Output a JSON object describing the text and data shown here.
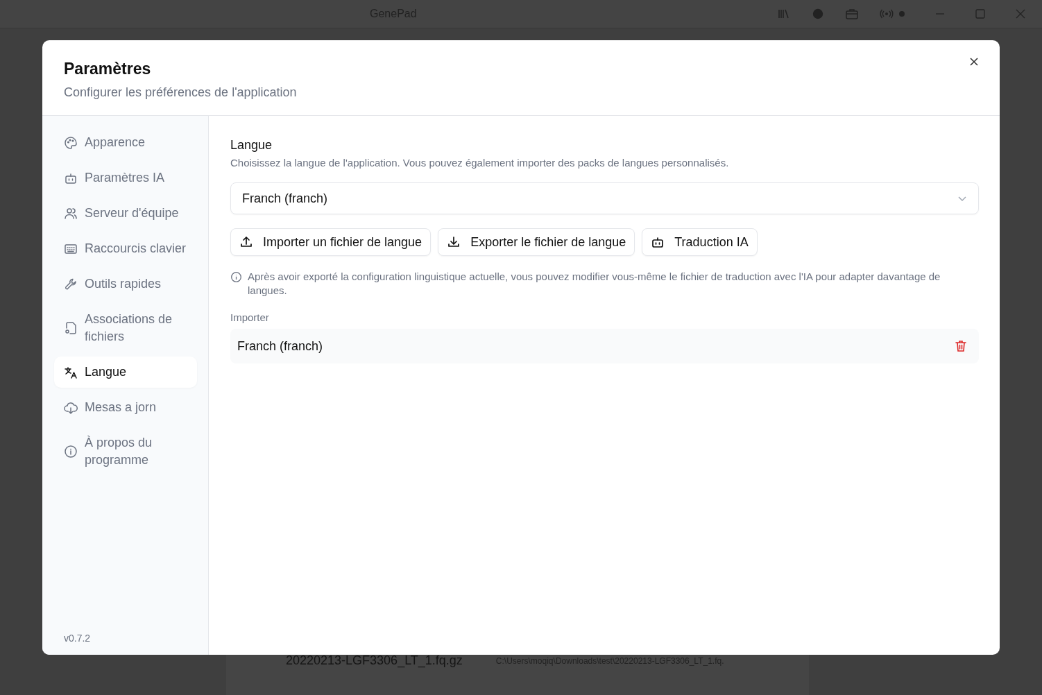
{
  "window": {
    "title": "GenePad"
  },
  "background": {
    "file_name": "20220213-LGF3306_LT_1.fq.gz",
    "file_path": "C:\\Users\\moqiq\\Downloads\\test\\20220213-LGF3306_LT_1.fq."
  },
  "dialog": {
    "title": "Paramètres",
    "subtitle": "Configurer les préférences de l'application",
    "sidebar": {
      "items": [
        {
          "label": "Apparence",
          "selected": false
        },
        {
          "label": "Paramètres IA",
          "selected": false
        },
        {
          "label": "Serveur d'équipe",
          "selected": false
        },
        {
          "label": "Raccourcis clavier",
          "selected": false
        },
        {
          "label": "Outils rapides",
          "selected": false
        },
        {
          "label": "Associations de fichiers",
          "selected": false
        },
        {
          "label": "Langue",
          "selected": true
        },
        {
          "label": "Mesas a jorn",
          "selected": false
        },
        {
          "label": "À propos du programme",
          "selected": false
        }
      ],
      "version": "v0.7.2"
    },
    "content": {
      "title": "Langue",
      "description": "Choisissez la langue de l'application. Vous pouvez également importer des packs de langues personnalisés.",
      "language_select": {
        "value": "Franch (franch)"
      },
      "buttons": [
        {
          "kind": "upload",
          "label": "Importer un fichier de langue"
        },
        {
          "kind": "download",
          "label": "Exporter le fichier de langue"
        },
        {
          "kind": "robot",
          "label": "Traduction IA"
        }
      ],
      "note": "Après avoir exporté la configuration linguistique actuelle, vous pouvez modifier vous-même le fichier de traduction avec l'IA pour adapter davantage de langues.",
      "imported_label": "Importer",
      "imported": [
        {
          "name": "Franch (franch)"
        }
      ]
    }
  }
}
